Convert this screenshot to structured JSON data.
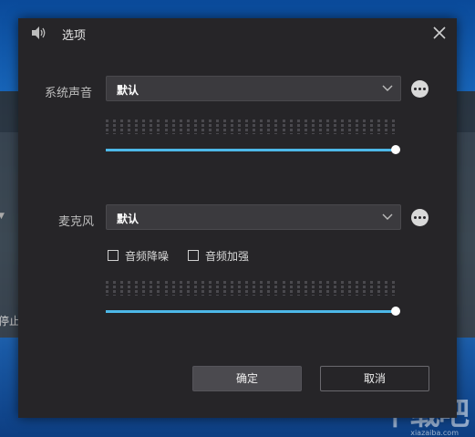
{
  "background": {
    "stop_fragment": "停止",
    "watermark": "下载吧",
    "watermark_sub": "xiazaiba.com"
  },
  "dialog": {
    "title": "选项",
    "title_icon": "speaker-icon",
    "close_icon": "close-icon"
  },
  "system_sound": {
    "label": "系统声音",
    "device": "默认",
    "volume_fraction": 1.0
  },
  "microphone": {
    "label": "麦克风",
    "device": "默认",
    "noise_reduction_label": "音频降噪",
    "noise_reduction_checked": false,
    "enhance_label": "音频加强",
    "enhance_checked": false,
    "volume_fraction": 1.0
  },
  "buttons": {
    "ok": "确定",
    "cancel": "取消"
  },
  "colors": {
    "accent": "#4db8e8",
    "dialog_bg": "#262528"
  }
}
